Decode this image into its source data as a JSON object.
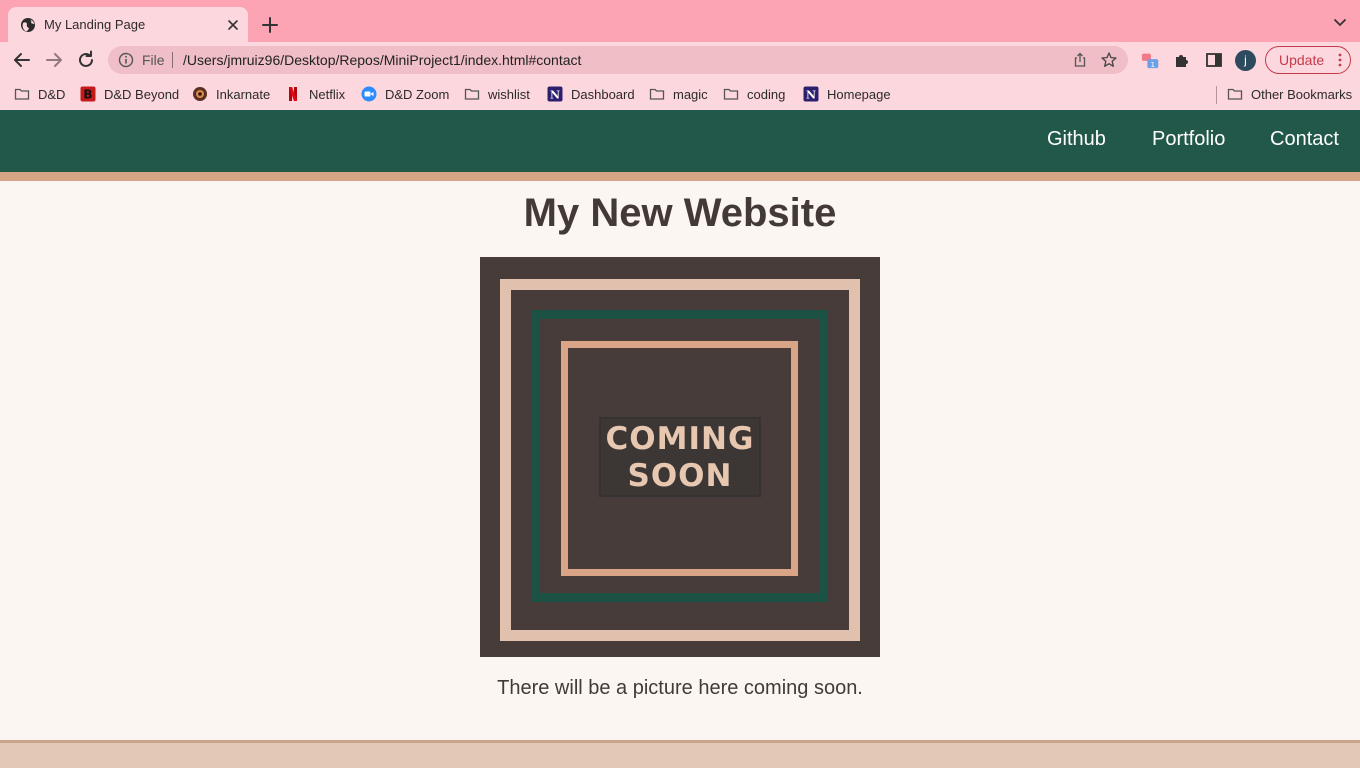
{
  "browser": {
    "tab": {
      "title": "My Landing Page"
    },
    "address": {
      "scheme_label": "File",
      "url": "/Users/jmruiz96/Desktop/Repos/MiniProject1/index.html#contact"
    },
    "extension_badge": "1",
    "profile_initial": "j",
    "update_label": "Update",
    "bookmarks": [
      {
        "label": "D&D",
        "icon": "folder-icon"
      },
      {
        "label": "D&D Beyond",
        "icon": "dndbeyond-icon"
      },
      {
        "label": "Inkarnate",
        "icon": "inkarnate-icon"
      },
      {
        "label": "Netflix",
        "icon": "netflix-icon"
      },
      {
        "label": "D&D Zoom",
        "icon": "zoom-icon"
      },
      {
        "label": "wishlist",
        "icon": "folder-icon"
      },
      {
        "label": "Dashboard",
        "icon": "notion-icon"
      },
      {
        "label": "magic",
        "icon": "folder-icon"
      },
      {
        "label": "coding",
        "icon": "folder-icon"
      },
      {
        "label": "Homepage",
        "icon": "notion-icon"
      }
    ],
    "other_bookmarks": "Other Bookmarks"
  },
  "site": {
    "nav": [
      {
        "label": "Github"
      },
      {
        "label": "Portfolio"
      },
      {
        "label": "Contact"
      }
    ],
    "title": "My New Website",
    "poster": {
      "line1": "COMING",
      "line2": "SOON"
    },
    "caption": "There will be a picture here coming soon."
  },
  "colors": {
    "tabstrip": "#fda4b4",
    "toolbar": "#fdd7de",
    "nav_bg": "#225849",
    "accent_tan": "#d4a484",
    "page_bg": "#fcf6f3",
    "text_dark": "#433a38",
    "poster_bg": "#473c3a"
  }
}
